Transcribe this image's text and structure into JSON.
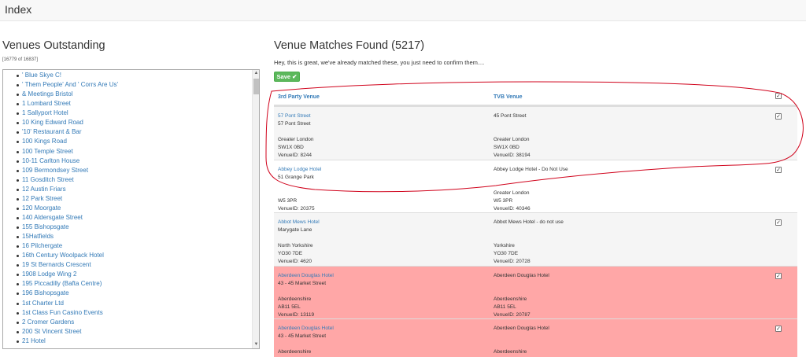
{
  "header": {
    "title": "Index"
  },
  "left": {
    "title": "Venues Outstanding",
    "count": "[16779 of 16837]",
    "venues": [
      "' Blue Skye C!",
      "' Them People' And ' Corrs Are Us'",
      "& Meetings Bristol",
      "1 Lombard Street",
      "1 Sallyport Hotel",
      "10 King Edward Road",
      "'10' Restaurant & Bar",
      "100 Kings Road",
      "100 Temple Street",
      "10-11 Carlton House",
      "109 Bermondsey Street",
      "11 Gosditch Street",
      "12 Austin Friars",
      "12 Park Street",
      "120 Moorgate",
      "140 Aldersgate Street",
      "155 Bishopsgate",
      "15Hatfields",
      "16 Pilchergate",
      "16th Century Woolpack Hotel",
      "19 St Bernards Crescent",
      "1908 Lodge Wing 2",
      "195 Piccadilly (Bafta Centre)",
      "196 Bishopsgate",
      "1st Charter Ltd",
      "1st Class Fun Casino Events",
      "2 Cromer Gardens",
      "200 St Vincent Street",
      "21 Hotel"
    ]
  },
  "right": {
    "title": "Venue Matches Found (5217)",
    "subtitle": "Hey, this is great, we've already matched these, you just need to confirm them....",
    "save_label": "Save ✔",
    "col_third_party": "3rd Party Venue",
    "col_tvb": "TVB Venue",
    "check_mark": "✓",
    "rows": [
      {
        "third": {
          "name": "57 Pont Street",
          "lines": [
            "57 Pont Street",
            "",
            "Greater London",
            "SW1X 0BD",
            "VenueID: 8244"
          ]
        },
        "tvb": {
          "name": "45 Pont Street",
          "lines": [
            "",
            "",
            "Greater London",
            "SW1X 0BD",
            "VenueID: 38194"
          ]
        }
      },
      {
        "third": {
          "name": "Abbey Lodge Hotel",
          "lines": [
            "51 Grange Park",
            "",
            "",
            "W5 3PR",
            "VenueID: 20375"
          ]
        },
        "tvb": {
          "name": "Abbey Lodge Hotel - Do Not Use",
          "lines": [
            "",
            "",
            "Greater London",
            "W5 3PR",
            "VenueID: 40346"
          ]
        }
      },
      {
        "third": {
          "name": "Abbot Mews Hotel",
          "lines": [
            "Marygate Lane",
            "",
            "North Yorkshire",
            "YO30 7DE",
            "VenueID: 4620"
          ]
        },
        "tvb": {
          "name": "Abbot Mews Hotel - do not use",
          "lines": [
            "",
            "",
            "Yorkshire",
            "YO30 7DE",
            "VenueID: 20728"
          ]
        }
      },
      {
        "third": {
          "name": "Aberdeen Douglas Hotel",
          "lines": [
            "43 - 45 Market Street",
            "",
            "Aberdeenshire",
            "AB11 5EL",
            "VenueID: 13119"
          ]
        },
        "tvb": {
          "name": "Aberdeen Douglas Hotel",
          "lines": [
            "",
            "",
            "Aberdeenshire",
            "AB11 5EL",
            "VenueID: 20787"
          ]
        }
      },
      {
        "third": {
          "name": "Aberdeen Douglas Hotel",
          "lines": [
            "43 - 45 Market Street",
            "",
            "Aberdeenshire",
            "AB11 5EL"
          ]
        },
        "tvb": {
          "name": "Aberdeen Douglas Hotel",
          "lines": [
            "",
            "",
            "Aberdeenshire",
            "AB11 5EL"
          ]
        }
      }
    ]
  },
  "colors": {
    "link": "#337ab7",
    "success": "#5cb85c",
    "danger_row": "#ffa7a7",
    "annotation": "#d0021b"
  }
}
